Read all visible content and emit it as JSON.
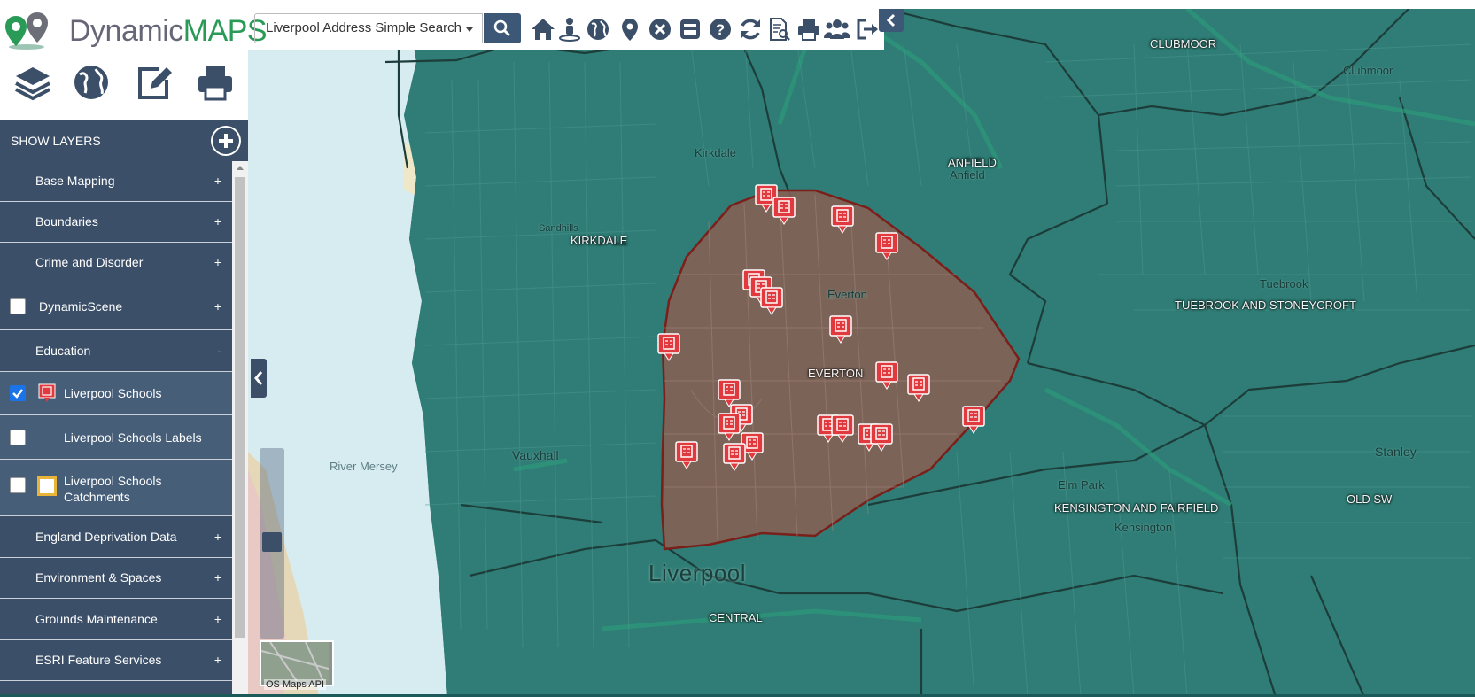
{
  "brand": {
    "name_part1": "Dynamic",
    "name_part2": "MAPS"
  },
  "search": {
    "selected": "Liverpool Address Simple Search"
  },
  "toolbar_icons": [
    "home-icon",
    "street-view-icon",
    "globe-icon",
    "map-marker-icon",
    "close-circle-icon",
    "window-icon",
    "help-icon",
    "refresh-icon",
    "document-search-icon",
    "print-icon",
    "users-icon",
    "sign-out-icon"
  ],
  "side_icons": [
    "layers-icon",
    "globe-icon",
    "edit-icon",
    "print-icon"
  ],
  "layers_header": "SHOW LAYERS",
  "layers": [
    {
      "label": "Base Mapping",
      "toggle": "+"
    },
    {
      "label": "Boundaries",
      "toggle": "+"
    },
    {
      "label": "Crime and Disorder",
      "toggle": "+"
    },
    {
      "label": "DynamicScene",
      "toggle": "+"
    },
    {
      "label": "Education",
      "toggle": "-"
    },
    {
      "label": "Liverpool Schools"
    },
    {
      "label": "Liverpool Schools Labels"
    },
    {
      "label": "Liverpool Schools Catchments"
    },
    {
      "label": "England Deprivation Data",
      "toggle": "+"
    },
    {
      "label": "Environment & Spaces",
      "toggle": "+"
    },
    {
      "label": "Grounds Maintenance",
      "toggle": "+"
    },
    {
      "label": "ESRI Feature Services",
      "toggle": "+"
    }
  ],
  "map_labels": {
    "clubmoor": "CLUBMOOR",
    "anfield": "ANFIELD",
    "kirkdale_caps": "KIRKDALE",
    "kirkdale": "Kirkdale",
    "everton_caps": "EVERTON",
    "everton": "Everton",
    "tuebrook_caps": "TUEBROOK AND STONEYCROFT",
    "tuebrook": "Tuebrook",
    "kensington_caps": "KENSINGTON AND FAIRFIELD",
    "kensington": "Kensington",
    "elmpark": "Elm Park",
    "stanley": "Stanley",
    "oldswan": "OLD SW",
    "liverpool": "Liverpool",
    "central": "CENTRAL",
    "vauxhall": "Vauxhall",
    "mersey": "River Mersey",
    "sandhills": "Sandhills",
    "anfield_small": "Anfield",
    "clubmoor_small": "Clubmoor"
  },
  "attribution": "OS Maps API",
  "colors": {
    "panel": "#3b4f69",
    "map_overlay": "#2f7d76",
    "catchment": "#8a5e54",
    "catchment_edge": "#7a1f1a",
    "school_marker": "#e0393e",
    "brand_green": "#2a9a57"
  }
}
